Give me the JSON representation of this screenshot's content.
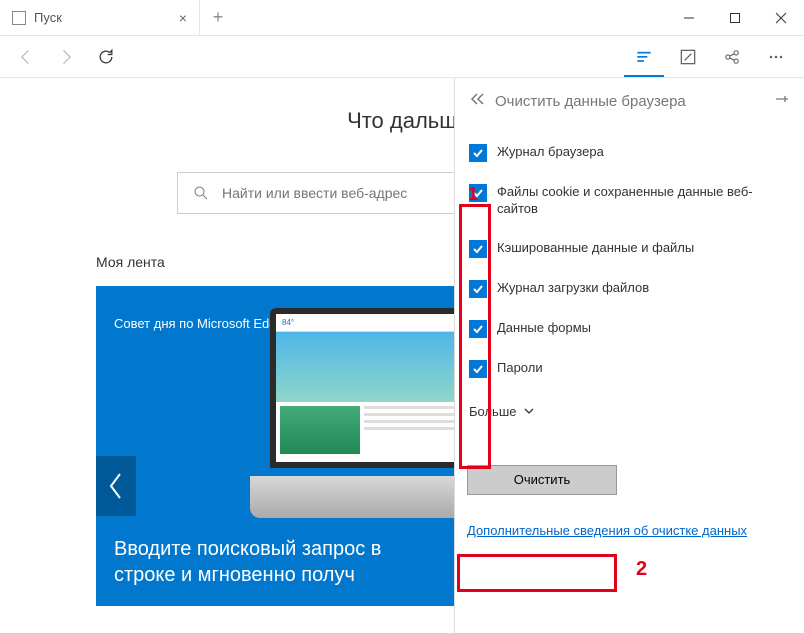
{
  "tab": {
    "title": "Пуск"
  },
  "hero": {
    "title": "Что дальш"
  },
  "search": {
    "placeholder": "Найти или ввести веб-адрес"
  },
  "feed": {
    "section_title": "Моя лента",
    "tip_label": "Совет дня по Microsoft Edge",
    "screen_badge": "84°",
    "card_text": "Вводите поисковый запрос в строке и мгновенно получ"
  },
  "panel": {
    "title": "Очистить данные браузера",
    "checkboxes": [
      {
        "label": "Журнал браузера",
        "checked": true
      },
      {
        "label": "Файлы cookie и сохраненные данные веб-сайтов",
        "checked": true
      },
      {
        "label": "Кэшированные данные и файлы",
        "checked": true
      },
      {
        "label": "Журнал загрузки файлов",
        "checked": true
      },
      {
        "label": "Данные формы",
        "checked": true
      },
      {
        "label": "Пароли",
        "checked": true
      }
    ],
    "more_label": "Больше",
    "clear_button": "Очистить",
    "info_link": "Дополнительные сведения об очистке данных"
  },
  "annotations": {
    "num1": "1",
    "num2": "2"
  }
}
